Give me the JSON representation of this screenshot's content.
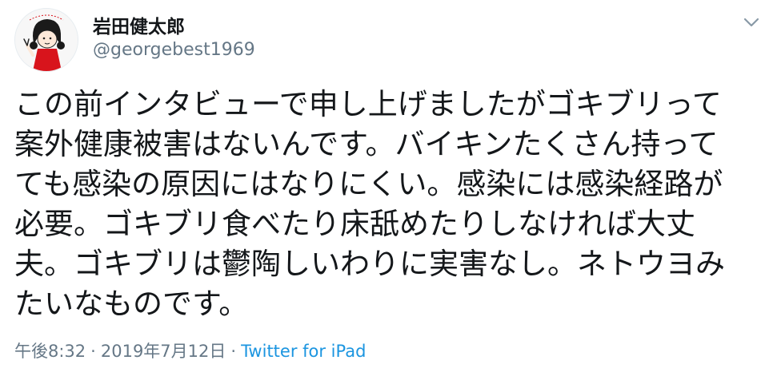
{
  "user": {
    "display_name": "岩田健太郎",
    "handle": "@georgebest1969",
    "avatar_icon": "cartoon-girl-avatar-icon"
  },
  "tweet": {
    "text": "この前インタビューで申し上げましたがゴキブリって\n案外健康被害はないんです。バイキンたくさん持って\nても感染の原因にはなりにくい。感染には感染経路が\n必要。ゴキブリ食べたり床舐めたりしなければ大丈\n夫。ゴキブリは鬱陶しいわりに実害なし。ネトウヨみ\nたいなものです。",
    "time": "午後8:32",
    "separator": "·",
    "date": "2019年7月12日",
    "source": "Twitter for iPad"
  },
  "menu": {
    "icon": "chevron-down-icon"
  },
  "colors": {
    "text": "#14171a",
    "secondary": "#657786",
    "link": "#1b95e0"
  }
}
